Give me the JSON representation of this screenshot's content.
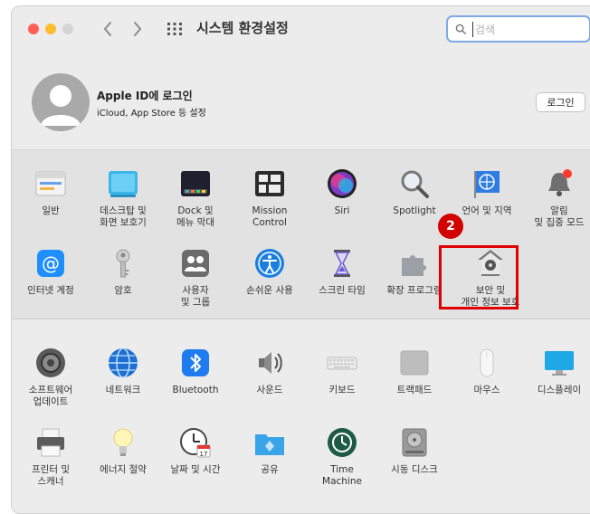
{
  "window": {
    "title": "시스템 환경설정"
  },
  "search": {
    "placeholder": "검색"
  },
  "profile": {
    "name": "Apple ID에 로그인",
    "subtitle": "iCloud, App Store 등 설정",
    "login_button": "로그인"
  },
  "colors": {
    "highlight": "#e00000",
    "badge": "#d30000",
    "search_border": "#7ea8e6"
  },
  "annotation": {
    "badge_number": "2"
  },
  "panes_row1": [
    {
      "label": "일반",
      "icon": "general-icon"
    },
    {
      "label": "데스크탑 및\n화면 보호기",
      "icon": "desktop-icon"
    },
    {
      "label": "Dock 및\n메뉴 막대",
      "icon": "dock-icon"
    },
    {
      "label": "Mission\nControl",
      "icon": "mission-control-icon"
    },
    {
      "label": "Siri",
      "icon": "siri-icon"
    },
    {
      "label": "Spotlight",
      "icon": "spotlight-icon"
    },
    {
      "label": "언어 및 지역",
      "icon": "language-region-icon"
    },
    {
      "label": "알림\n및 집중 모드",
      "icon": "notifications-icon"
    }
  ],
  "panes_row2": [
    {
      "label": "인터넷 계정",
      "icon": "internet-accounts-icon"
    },
    {
      "label": "암호",
      "icon": "passwords-icon"
    },
    {
      "label": "사용자\n및 그룹",
      "icon": "users-groups-icon"
    },
    {
      "label": "손쉬운 사용",
      "icon": "accessibility-icon"
    },
    {
      "label": "스크린 타임",
      "icon": "screen-time-icon"
    },
    {
      "label": "확장 프로그램",
      "icon": "extensions-icon"
    },
    {
      "label": "보안 및\n개인 정보 보호",
      "icon": "security-privacy-icon"
    }
  ],
  "panes_row3": [
    {
      "label": "소프트웨어\n업데이트",
      "icon": "software-update-icon"
    },
    {
      "label": "네트워크",
      "icon": "network-icon"
    },
    {
      "label": "Bluetooth",
      "icon": "bluetooth-icon"
    },
    {
      "label": "사운드",
      "icon": "sound-icon"
    },
    {
      "label": "키보드",
      "icon": "keyboard-icon"
    },
    {
      "label": "트랙패드",
      "icon": "trackpad-icon"
    },
    {
      "label": "마우스",
      "icon": "mouse-icon"
    },
    {
      "label": "디스플레이",
      "icon": "displays-icon"
    }
  ],
  "panes_row4": [
    {
      "label": "프린터 및\n스캐너",
      "icon": "printers-scanners-icon"
    },
    {
      "label": "에너지 절약",
      "icon": "energy-saver-icon"
    },
    {
      "label": "날짜 및 시간",
      "icon": "date-time-icon"
    },
    {
      "label": "공유",
      "icon": "sharing-icon"
    },
    {
      "label": "Time\nMachine",
      "icon": "time-machine-icon"
    },
    {
      "label": "시동 디스크",
      "icon": "startup-disk-icon"
    }
  ]
}
